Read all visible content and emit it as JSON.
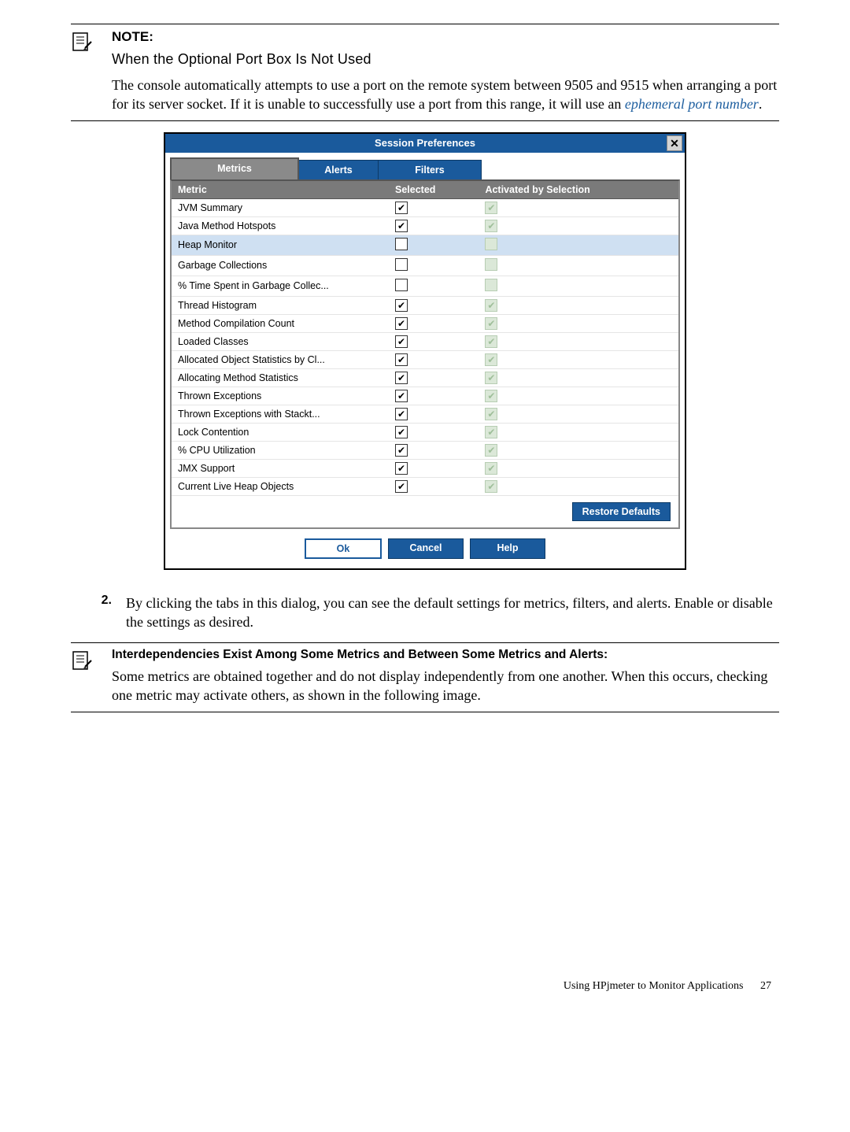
{
  "note1": {
    "label": "NOTE:",
    "subtitle": "When the Optional Port Box Is Not Used",
    "text_before": "The console automatically attempts to use a port on the remote system between 9505 and 9515 when arranging a port for its server socket. If it is unable to successfully use a port from this range, it will use an ",
    "ephemeral": "ephemeral port number",
    "text_after": "."
  },
  "dialog": {
    "title": "Session Preferences",
    "tabs": {
      "metrics": "Metrics",
      "alerts": "Alerts",
      "filters": "Filters"
    },
    "columns": {
      "metric": "Metric",
      "selected": "Selected",
      "activated": "Activated by Selection"
    },
    "rows": [
      {
        "name": "JVM Summary",
        "selected": true,
        "activated": "checked-linked"
      },
      {
        "name": "Java Method Hotspots",
        "selected": true,
        "activated": "checked-linked"
      },
      {
        "name": "Heap Monitor",
        "selected": false,
        "activated": "empty-linked",
        "highlight": true
      },
      {
        "name": "Garbage Collections",
        "selected": false,
        "activated": "empty-linked"
      },
      {
        "name": "% Time Spent in Garbage Collec...",
        "selected": false,
        "activated": "empty-linked"
      },
      {
        "name": "Thread Histogram",
        "selected": true,
        "activated": "checked-linked"
      },
      {
        "name": "Method Compilation Count",
        "selected": true,
        "activated": "checked-linked"
      },
      {
        "name": "Loaded Classes",
        "selected": true,
        "activated": "checked-linked"
      },
      {
        "name": "Allocated Object Statistics by Cl...",
        "selected": true,
        "activated": "checked-linked"
      },
      {
        "name": "Allocating Method Statistics",
        "selected": true,
        "activated": "checked-linked"
      },
      {
        "name": "Thrown Exceptions",
        "selected": true,
        "activated": "checked-linked"
      },
      {
        "name": "Thrown Exceptions with Stackt...",
        "selected": true,
        "activated": "checked-linked"
      },
      {
        "name": "Lock Contention",
        "selected": true,
        "activated": "checked-linked"
      },
      {
        "name": "% CPU Utilization",
        "selected": true,
        "activated": "checked-linked"
      },
      {
        "name": "JMX Support",
        "selected": true,
        "activated": "checked-linked"
      },
      {
        "name": "Current Live Heap Objects",
        "selected": true,
        "activated": "checked-linked"
      }
    ],
    "buttons": {
      "restore": "Restore Defaults",
      "ok": "Ok",
      "cancel": "Cancel",
      "help": "Help"
    }
  },
  "step2": {
    "num": "2.",
    "text": "By clicking the tabs in this dialog, you can see the default settings for metrics, filters, and alerts. Enable or disable the settings as desired."
  },
  "note2": {
    "title": "Interdependencies Exist Among Some Metrics and Between Some Metrics and Alerts:",
    "text": "Some metrics are obtained together and do not display independently from one another. When this occurs, checking one metric may activate others, as shown in the following image."
  },
  "footer": {
    "title": "Using HPjmeter to Monitor Applications",
    "page": "27"
  }
}
